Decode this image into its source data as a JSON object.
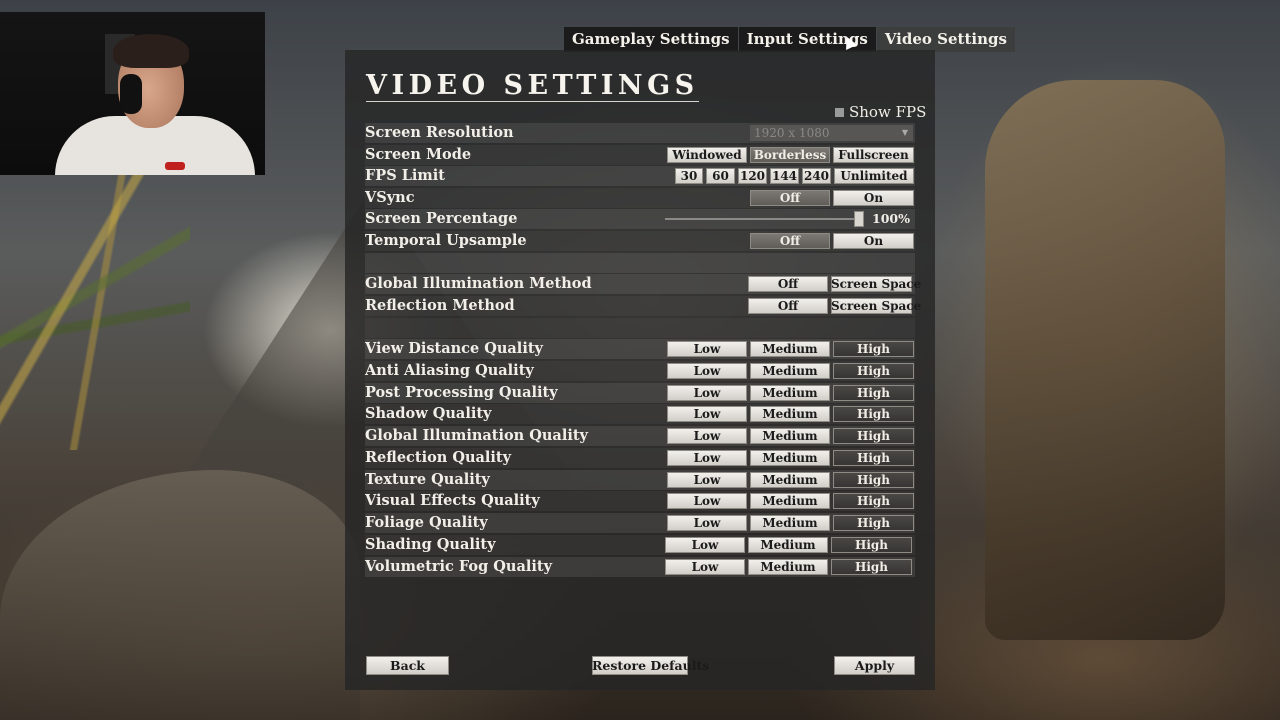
{
  "tabs": [
    {
      "label": "Gameplay Settings"
    },
    {
      "label": "Input Settings"
    },
    {
      "label": "Video Settings"
    }
  ],
  "title": "VIDEO SETTINGS",
  "show_fps": {
    "label": "Show FPS",
    "checked": false
  },
  "settings": {
    "screen_resolution": {
      "label": "Screen Resolution",
      "value": "1920 x 1080"
    },
    "screen_mode": {
      "label": "Screen Mode",
      "options": [
        "Windowed",
        "Borderless",
        "Fullscreen"
      ],
      "selected": "Borderless"
    },
    "fps_limit": {
      "label": "FPS Limit",
      "options": [
        "30",
        "60",
        "120",
        "144",
        "240",
        "Unlimited"
      ]
    },
    "vsync": {
      "label": "VSync",
      "options": [
        "Off",
        "On"
      ],
      "selected": "Off"
    },
    "screen_percentage": {
      "label": "Screen Percentage",
      "value": "100%",
      "level": 1.0
    },
    "temporal_upsample": {
      "label": "Temporal Upsample",
      "options": [
        "Off",
        "On"
      ],
      "selected": "Off"
    },
    "global_illumination_method": {
      "label": "Global Illumination Method",
      "options": [
        "Off",
        "Screen Space"
      ]
    },
    "reflection_method": {
      "label": "Reflection Method",
      "options": [
        "Off",
        "Screen Space"
      ]
    }
  },
  "quality_options": [
    "Low",
    "Medium",
    "High"
  ],
  "quality": [
    {
      "label": "View Distance Quality",
      "selected": "High"
    },
    {
      "label": "Anti Aliasing Quality",
      "selected": "High"
    },
    {
      "label": "Post Processing Quality",
      "selected": "High"
    },
    {
      "label": "Shadow Quality",
      "selected": "High"
    },
    {
      "label": "Global Illumination Quality",
      "selected": "High"
    },
    {
      "label": "Reflection Quality",
      "selected": "High"
    },
    {
      "label": "Texture Quality",
      "selected": "High"
    },
    {
      "label": "Visual Effects Quality",
      "selected": "High"
    },
    {
      "label": "Foliage Quality",
      "selected": "High"
    },
    {
      "label": "Shading Quality",
      "selected": "High"
    },
    {
      "label": "Volumetric Fog Quality",
      "selected": "High"
    }
  ],
  "footer": {
    "back": "Back",
    "restore": "Restore Defaults",
    "apply": "Apply"
  }
}
